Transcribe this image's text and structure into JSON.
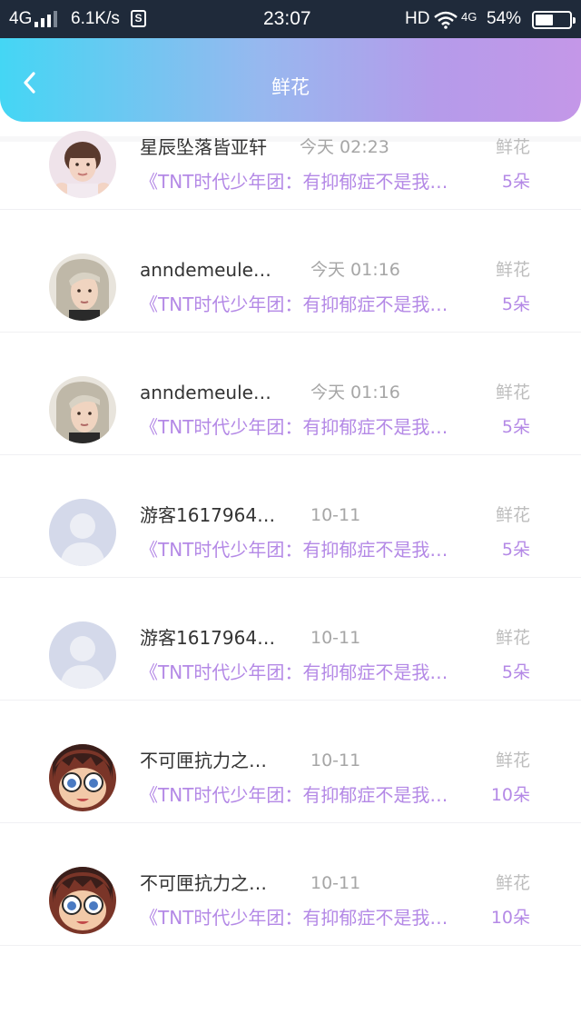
{
  "status_bar": {
    "network": "4G",
    "speed": "6.1K/s",
    "s_badge": "S",
    "time": "23:07",
    "hd": "HD",
    "mobile_data": "4G",
    "battery_percent": "54%",
    "battery_level": 0.54
  },
  "header": {
    "title": "鲜花",
    "back_icon": "chevron-left-icon"
  },
  "items": [
    {
      "name": "星辰坠落皆亚轩",
      "time": "今天 02:23",
      "gift": "鲜花",
      "desc": "《TNT时代少年团：有抑郁症不是我…",
      "count": "5朵",
      "avatar": "boy-portrait"
    },
    {
      "name": "anndemeule…",
      "time": "今天 01:16",
      "gift": "鲜花",
      "desc": "《TNT时代少年团：有抑郁症不是我…",
      "count": "5朵",
      "avatar": "silver-hair-portrait"
    },
    {
      "name": "anndemeule…",
      "time": "今天 01:16",
      "gift": "鲜花",
      "desc": "《TNT时代少年团：有抑郁症不是我…",
      "count": "5朵",
      "avatar": "silver-hair-portrait"
    },
    {
      "name": "游客1617964…",
      "time": "10-11",
      "gift": "鲜花",
      "desc": "《TNT时代少年团：有抑郁症不是我…",
      "count": "5朵",
      "avatar": "default-user"
    },
    {
      "name": "游客1617964…",
      "time": "10-11",
      "gift": "鲜花",
      "desc": "《TNT时代少年团：有抑郁症不是我…",
      "count": "5朵",
      "avatar": "default-user"
    },
    {
      "name": "不可匣抗力之…",
      "time": "10-11",
      "gift": "鲜花",
      "desc": "《TNT时代少年团：有抑郁症不是我…",
      "count": "10朵",
      "avatar": "anime-glasses"
    },
    {
      "name": "不可匣抗力之…",
      "time": "10-11",
      "gift": "鲜花",
      "desc": "《TNT时代少年团：有抑郁症不是我…",
      "count": "10朵",
      "avatar": "anime-glasses"
    }
  ],
  "colors": {
    "accent": "#b489e6",
    "header_gradient_start": "#44d6f4",
    "header_gradient_end": "#c497e8",
    "status_bar_bg": "#1f2a3a"
  }
}
